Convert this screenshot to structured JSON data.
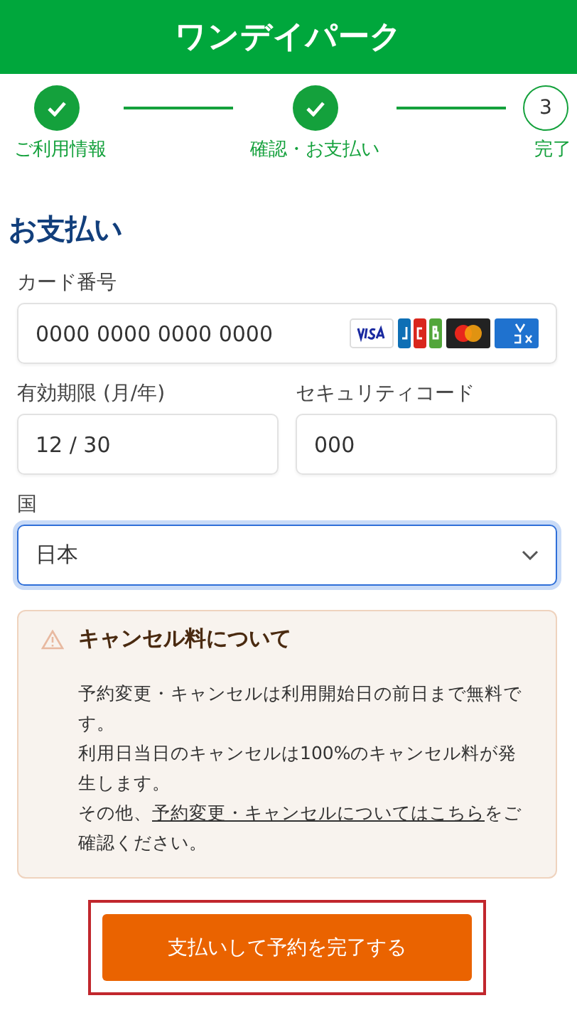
{
  "header": {
    "logo": "ワンデイパーク"
  },
  "steps": [
    {
      "label": "ご利用情報",
      "done": true
    },
    {
      "label": "確認・お支払い",
      "done": true
    },
    {
      "label": "完了",
      "number": "3",
      "done": false
    }
  ],
  "title": "お支払い",
  "card_number": {
    "label": "カード番号",
    "value": "0000 0000 0000 0000",
    "brands": [
      {
        "kind": "visa"
      },
      {
        "kind": "jcb"
      },
      {
        "kind": "mastercard"
      },
      {
        "kind": "amex"
      }
    ]
  },
  "expiry": {
    "label": "有効期限 (月/年)",
    "value": "12 / 30"
  },
  "security_code": {
    "label": "セキュリティコード",
    "value": "000"
  },
  "country": {
    "label": "国",
    "value": "日本",
    "focused": true
  },
  "notice": {
    "title": "キャンセル料について",
    "paragraphs": [
      {
        "text": "予約変更・キャンセルは利用開始日の前日まで無料です。"
      },
      {
        "text": "利用日当日のキャンセルは100%のキャンセル料が発生します。"
      },
      {
        "text": "その他、",
        "link": "予約変更・キャンセルについてはこちら",
        "after": "をご確認ください。"
      }
    ]
  },
  "submit": {
    "label": "支払いして予約を完了する",
    "highlighted": true
  }
}
